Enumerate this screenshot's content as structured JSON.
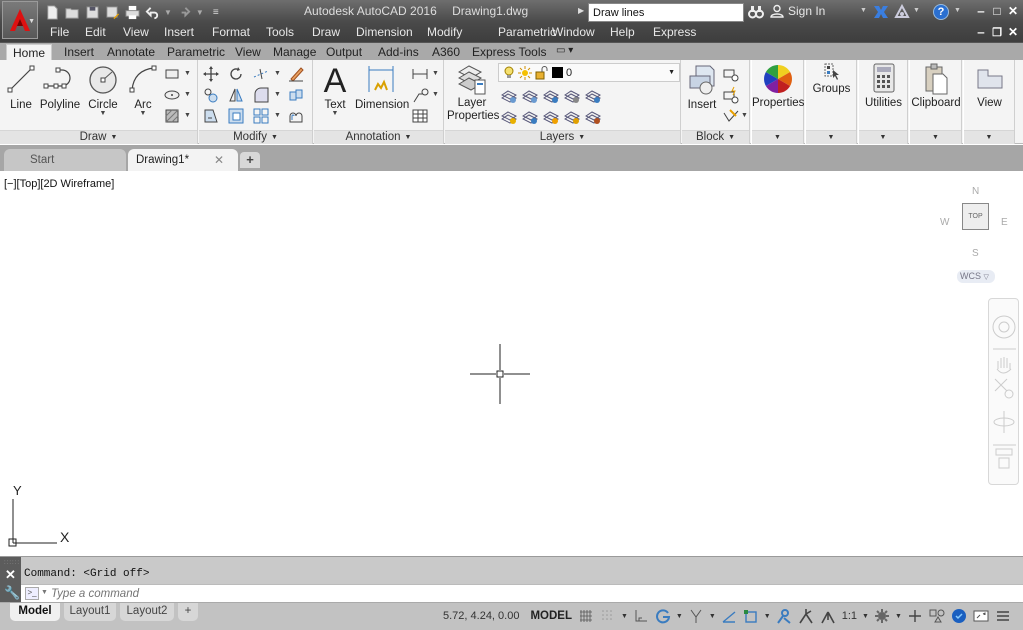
{
  "window": {
    "app_name": "Autodesk AutoCAD 2016",
    "document": "Drawing1.dwg",
    "search_value": "Draw lines",
    "sign_in": "Sign In"
  },
  "quick_access": {
    "icons": [
      "new-icon",
      "open-icon",
      "save-icon",
      "save-as-icon",
      "plot-icon",
      "undo-icon",
      "redo-icon",
      "customize-icon"
    ]
  },
  "menubar": [
    "File",
    "Edit",
    "View",
    "Insert",
    "Format",
    "Tools",
    "Draw",
    "Dimension",
    "Modify",
    "Parametric",
    "Window",
    "Help",
    "Express"
  ],
  "ribbon_tabs": [
    "Home",
    "Insert",
    "Annotate",
    "Parametric",
    "View",
    "Manage",
    "Output",
    "Add-ins",
    "A360",
    "Express Tools"
  ],
  "ribbon_active_tab": "Home",
  "ribbon": {
    "draw": {
      "title": "Draw",
      "line": "Line",
      "polyline": "Polyline",
      "circle": "Circle",
      "arc": "Arc"
    },
    "modify": {
      "title": "Modify"
    },
    "annotation": {
      "title": "Annotation",
      "text": "Text",
      "dimension": "Dimension"
    },
    "layers": {
      "title": "Layers",
      "layer_properties_1": "Layer",
      "layer_properties_2": "Properties",
      "current_layer": "0"
    },
    "block": {
      "title": "Block",
      "insert": "Insert"
    },
    "properties": "Properties",
    "groups": "Groups",
    "utilities": "Utilities",
    "clipboard": "Clipboard",
    "view": "View"
  },
  "file_tabs": {
    "start": "Start",
    "drawing": "Drawing1*",
    "new": "+"
  },
  "viewport": {
    "label": "[−][Top][2D Wireframe]",
    "viewcube": {
      "n": "N",
      "s": "S",
      "e": "E",
      "w": "W",
      "face": "TOP",
      "ucs": "WCS"
    },
    "ucs_x": "X",
    "ucs_y": "Y"
  },
  "command": {
    "history": "Command:  <Grid off>",
    "placeholder": "Type a command"
  },
  "layout_tabs": [
    "Model",
    "Layout1",
    "Layout2",
    "+"
  ],
  "status": {
    "coords": "5.72, 4.24, 0.00",
    "space": "MODEL",
    "annotation_scale": "1:1"
  }
}
